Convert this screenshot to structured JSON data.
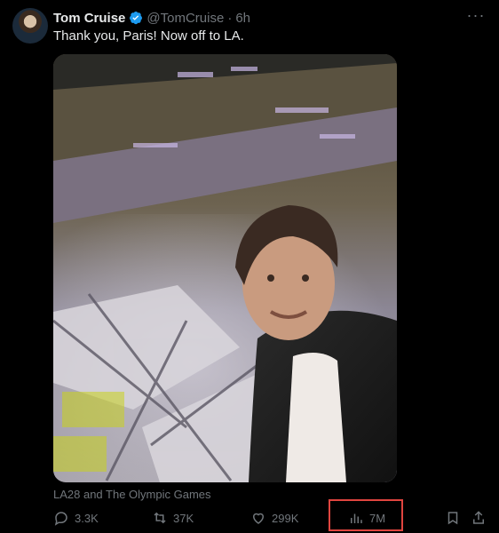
{
  "tweet": {
    "author_name": "Tom Cruise",
    "handle": "@TomCruise",
    "separator": "·",
    "time": "6h",
    "text": "Thank you, Paris! Now off to LA.",
    "attribution": "LA28 and The Olympic Games"
  },
  "actions": {
    "replies": "3.3K",
    "reposts": "37K",
    "likes": "299K",
    "views": "7M"
  },
  "colors": {
    "verified": "#1d9bf0",
    "highlight": "#e0453f",
    "muted": "#71767b"
  }
}
